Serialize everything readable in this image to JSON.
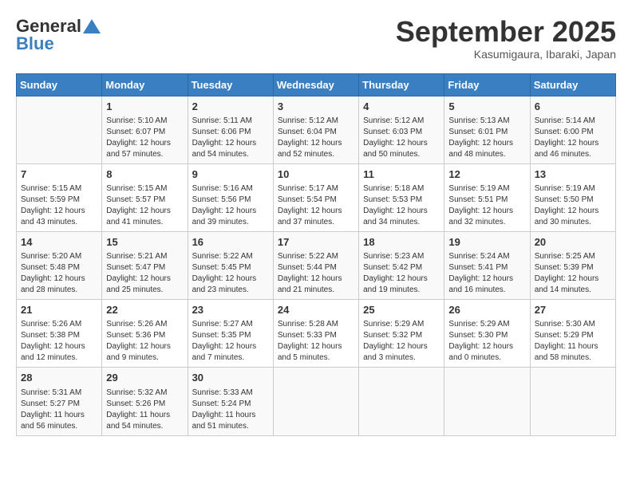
{
  "logo": {
    "line1": "General",
    "line2": "Blue"
  },
  "title": "September 2025",
  "location": "Kasumigaura, Ibaraki, Japan",
  "weekdays": [
    "Sunday",
    "Monday",
    "Tuesday",
    "Wednesday",
    "Thursday",
    "Friday",
    "Saturday"
  ],
  "weeks": [
    [
      {
        "day": "",
        "info": ""
      },
      {
        "day": "1",
        "info": "Sunrise: 5:10 AM\nSunset: 6:07 PM\nDaylight: 12 hours\nand 57 minutes."
      },
      {
        "day": "2",
        "info": "Sunrise: 5:11 AM\nSunset: 6:06 PM\nDaylight: 12 hours\nand 54 minutes."
      },
      {
        "day": "3",
        "info": "Sunrise: 5:12 AM\nSunset: 6:04 PM\nDaylight: 12 hours\nand 52 minutes."
      },
      {
        "day": "4",
        "info": "Sunrise: 5:12 AM\nSunset: 6:03 PM\nDaylight: 12 hours\nand 50 minutes."
      },
      {
        "day": "5",
        "info": "Sunrise: 5:13 AM\nSunset: 6:01 PM\nDaylight: 12 hours\nand 48 minutes."
      },
      {
        "day": "6",
        "info": "Sunrise: 5:14 AM\nSunset: 6:00 PM\nDaylight: 12 hours\nand 46 minutes."
      }
    ],
    [
      {
        "day": "7",
        "info": "Sunrise: 5:15 AM\nSunset: 5:59 PM\nDaylight: 12 hours\nand 43 minutes."
      },
      {
        "day": "8",
        "info": "Sunrise: 5:15 AM\nSunset: 5:57 PM\nDaylight: 12 hours\nand 41 minutes."
      },
      {
        "day": "9",
        "info": "Sunrise: 5:16 AM\nSunset: 5:56 PM\nDaylight: 12 hours\nand 39 minutes."
      },
      {
        "day": "10",
        "info": "Sunrise: 5:17 AM\nSunset: 5:54 PM\nDaylight: 12 hours\nand 37 minutes."
      },
      {
        "day": "11",
        "info": "Sunrise: 5:18 AM\nSunset: 5:53 PM\nDaylight: 12 hours\nand 34 minutes."
      },
      {
        "day": "12",
        "info": "Sunrise: 5:19 AM\nSunset: 5:51 PM\nDaylight: 12 hours\nand 32 minutes."
      },
      {
        "day": "13",
        "info": "Sunrise: 5:19 AM\nSunset: 5:50 PM\nDaylight: 12 hours\nand 30 minutes."
      }
    ],
    [
      {
        "day": "14",
        "info": "Sunrise: 5:20 AM\nSunset: 5:48 PM\nDaylight: 12 hours\nand 28 minutes."
      },
      {
        "day": "15",
        "info": "Sunrise: 5:21 AM\nSunset: 5:47 PM\nDaylight: 12 hours\nand 25 minutes."
      },
      {
        "day": "16",
        "info": "Sunrise: 5:22 AM\nSunset: 5:45 PM\nDaylight: 12 hours\nand 23 minutes."
      },
      {
        "day": "17",
        "info": "Sunrise: 5:22 AM\nSunset: 5:44 PM\nDaylight: 12 hours\nand 21 minutes."
      },
      {
        "day": "18",
        "info": "Sunrise: 5:23 AM\nSunset: 5:42 PM\nDaylight: 12 hours\nand 19 minutes."
      },
      {
        "day": "19",
        "info": "Sunrise: 5:24 AM\nSunset: 5:41 PM\nDaylight: 12 hours\nand 16 minutes."
      },
      {
        "day": "20",
        "info": "Sunrise: 5:25 AM\nSunset: 5:39 PM\nDaylight: 12 hours\nand 14 minutes."
      }
    ],
    [
      {
        "day": "21",
        "info": "Sunrise: 5:26 AM\nSunset: 5:38 PM\nDaylight: 12 hours\nand 12 minutes."
      },
      {
        "day": "22",
        "info": "Sunrise: 5:26 AM\nSunset: 5:36 PM\nDaylight: 12 hours\nand 9 minutes."
      },
      {
        "day": "23",
        "info": "Sunrise: 5:27 AM\nSunset: 5:35 PM\nDaylight: 12 hours\nand 7 minutes."
      },
      {
        "day": "24",
        "info": "Sunrise: 5:28 AM\nSunset: 5:33 PM\nDaylight: 12 hours\nand 5 minutes."
      },
      {
        "day": "25",
        "info": "Sunrise: 5:29 AM\nSunset: 5:32 PM\nDaylight: 12 hours\nand 3 minutes."
      },
      {
        "day": "26",
        "info": "Sunrise: 5:29 AM\nSunset: 5:30 PM\nDaylight: 12 hours\nand 0 minutes."
      },
      {
        "day": "27",
        "info": "Sunrise: 5:30 AM\nSunset: 5:29 PM\nDaylight: 11 hours\nand 58 minutes."
      }
    ],
    [
      {
        "day": "28",
        "info": "Sunrise: 5:31 AM\nSunset: 5:27 PM\nDaylight: 11 hours\nand 56 minutes."
      },
      {
        "day": "29",
        "info": "Sunrise: 5:32 AM\nSunset: 5:26 PM\nDaylight: 11 hours\nand 54 minutes."
      },
      {
        "day": "30",
        "info": "Sunrise: 5:33 AM\nSunset: 5:24 PM\nDaylight: 11 hours\nand 51 minutes."
      },
      {
        "day": "",
        "info": ""
      },
      {
        "day": "",
        "info": ""
      },
      {
        "day": "",
        "info": ""
      },
      {
        "day": "",
        "info": ""
      }
    ]
  ]
}
